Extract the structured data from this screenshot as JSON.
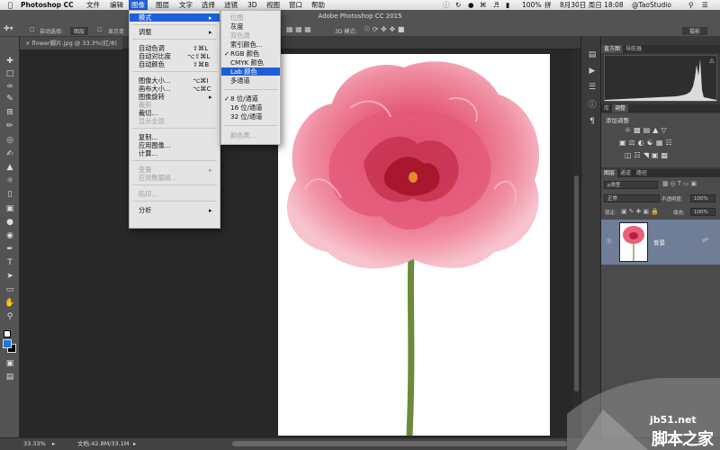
{
  "menubar": {
    "apple": "",
    "app_name": "Photoshop CC",
    "items": [
      "文件",
      "编辑",
      "图像",
      "图层",
      "文字",
      "选择",
      "滤镜",
      "3D",
      "视图",
      "窗口",
      "帮助"
    ],
    "status": {
      "battery": "100%",
      "input": "拼",
      "date": "8月30日 周日 18:08",
      "user": "@TaoStudio"
    }
  },
  "options_bar": {
    "auto_select": "自动选择:",
    "auto_select_value": "图层",
    "show_transform": "显示变",
    "mode_3d": "3D 模式:",
    "workspace": "摄影"
  },
  "window_title": "Adobe Photoshop CC 2015",
  "document_tab": "flower脚片.jpg @ 33.3%(红/8)",
  "image_menu": {
    "items": [
      {
        "label": "模式",
        "shortcut": "",
        "submenu": true,
        "highlight": true
      },
      {
        "label": "调整",
        "shortcut": "",
        "submenu": true
      },
      {
        "label": "自动色调",
        "shortcut": "⇧⌘L"
      },
      {
        "label": "自动对比度",
        "shortcut": "⌥⇧⌘L"
      },
      {
        "label": "自动颜色",
        "shortcut": "⇧⌘B"
      },
      {
        "label": "图像大小...",
        "shortcut": "⌥⌘I"
      },
      {
        "label": "画布大小...",
        "shortcut": "⌥⌘C"
      },
      {
        "label": "图像旋转",
        "shortcut": "",
        "submenu": true
      },
      {
        "label": "裁剪",
        "shortcut": "",
        "disabled": true
      },
      {
        "label": "裁切...",
        "shortcut": ""
      },
      {
        "label": "显示全部",
        "shortcut": "",
        "disabled": true
      },
      {
        "label": "复制...",
        "shortcut": ""
      },
      {
        "label": "应用图像...",
        "shortcut": ""
      },
      {
        "label": "计算...",
        "shortcut": ""
      },
      {
        "label": "变量",
        "shortcut": "",
        "submenu": true,
        "disabled": true
      },
      {
        "label": "应用数据组...",
        "shortcut": "",
        "disabled": true
      },
      {
        "label": "陷印...",
        "shortcut": "",
        "disabled": true
      },
      {
        "label": "分析",
        "shortcut": "",
        "submenu": true
      }
    ]
  },
  "mode_submenu": {
    "items": [
      {
        "label": "位图",
        "disabled": true
      },
      {
        "label": "灰度"
      },
      {
        "label": "双色调",
        "disabled": true
      },
      {
        "label": "索引颜色..."
      },
      {
        "label": "RGB 颜色",
        "checked": true
      },
      {
        "label": "CMYK 颜色"
      },
      {
        "label": "Lab 颜色",
        "highlight": true
      },
      {
        "label": "多通道"
      },
      {
        "label": "8 位/通道",
        "checked": true
      },
      {
        "label": "16 位/通道"
      },
      {
        "label": "32 位/通道"
      },
      {
        "label": "颜色表...",
        "disabled": true
      }
    ]
  },
  "panels": {
    "histogram_tabs": [
      "直方图",
      "导航器"
    ],
    "adjust_tabs": [
      "库",
      "调整"
    ],
    "adjust_title": "添加调整",
    "layers_tabs": [
      "图层",
      "通道",
      "路径"
    ],
    "filter_kind": "ρ类型",
    "blend_mode": "正常",
    "opacity_label": "不透明度:",
    "opacity_value": "100%",
    "lock_label": "锁定:",
    "fill_label": "填充:",
    "fill_value": "100%",
    "layer_name": "背景"
  },
  "statusbar": {
    "zoom": "33.33%",
    "doc_info": "文档:42.8M/33.1M"
  },
  "watermark": {
    "site": "jb51.net",
    "name": "脚本之家"
  },
  "colors": {
    "menu_highlight": "#1d5fd8",
    "layer_selected": "#6f7d96",
    "panel_bg": "#4b4b4b",
    "canvas_bg": "#282828",
    "flower_pink": "#e8607a",
    "stem_green": "#6c8a3c"
  }
}
